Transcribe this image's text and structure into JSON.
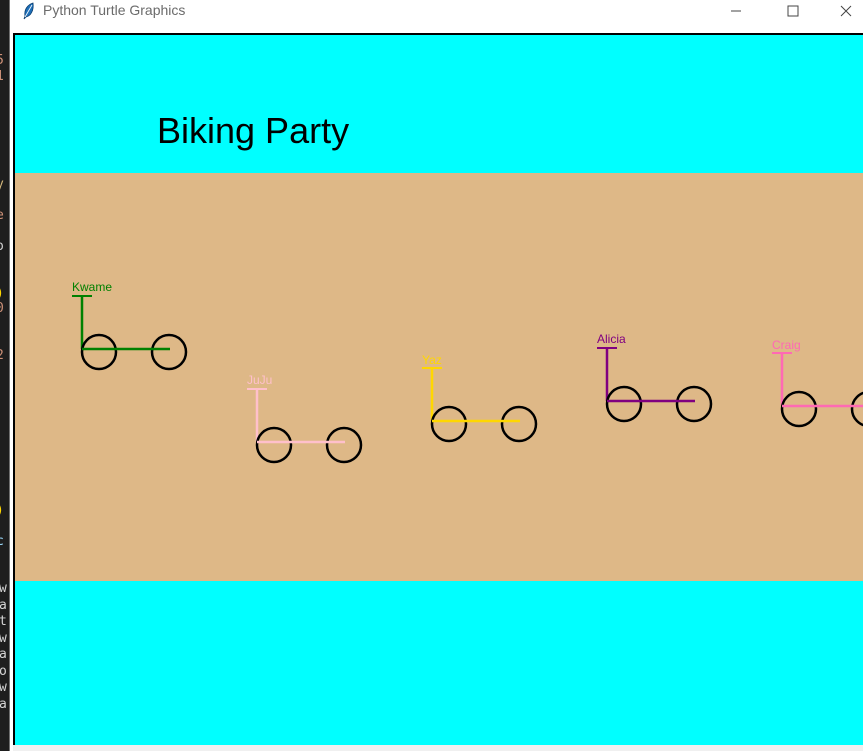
{
  "background_editor": {
    "upper_glyphs": [
      "5",
      "1",
      "",
      "",
      "",
      "",
      "",
      "",
      "y",
      "",
      "e",
      "",
      "o",
      "",
      "",
      ")",
      "0",
      "",
      "",
      "2",
      "",
      "",
      "",
      "",
      "",
      "",
      "",
      "",
      "",
      ")",
      "",
      "c"
    ],
    "lower_glyphs": [
      "w",
      "a",
      "t",
      "w",
      "a",
      "o",
      "w",
      "a"
    ]
  },
  "window": {
    "title": "Python Turtle Graphics",
    "icon": "feather-icon",
    "controls": [
      "minimize-icon",
      "maximize-icon",
      "close-icon"
    ]
  },
  "canvas": {
    "title": "Biking Party",
    "sky_color": "#00ffff",
    "road_color": "#deb887",
    "riders": [
      {
        "name": "Kwame",
        "color": "#008000"
      },
      {
        "name": "JuJu",
        "color": "#ffc0cb"
      },
      {
        "name": "Yaz",
        "color": "#ffd700"
      },
      {
        "name": "Alicia",
        "color": "#800080"
      },
      {
        "name": "Craig",
        "color": "#ff69b4"
      }
    ]
  }
}
